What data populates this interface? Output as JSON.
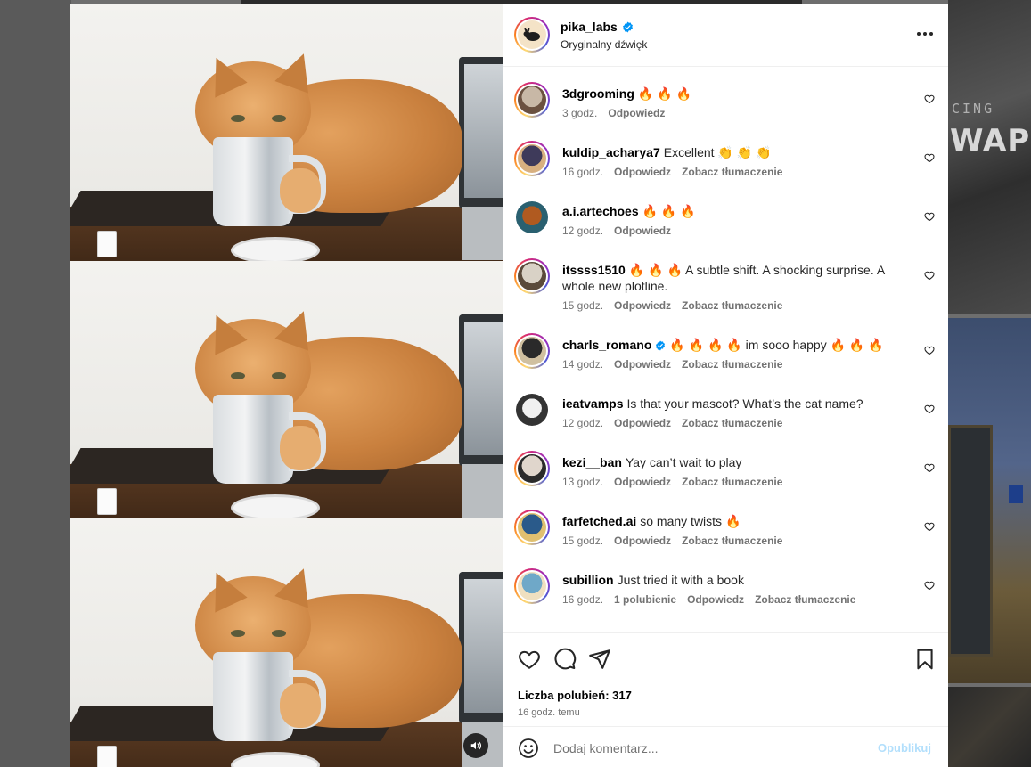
{
  "background": {
    "right_card_word_1": "CING",
    "right_card_word_2": "WAPS"
  },
  "post": {
    "author": {
      "username": "pika_labs",
      "verified": true,
      "audio": "Oryginalny dźwięk"
    },
    "comments": [
      {
        "username": "3dgrooming",
        "text": "🔥 🔥 🔥",
        "time": "3 godz.",
        "likes": "",
        "reply": "Odpowiedz",
        "translate": "",
        "ring": true
      },
      {
        "username": "kuldip_acharya7",
        "text": "Excellent 👏 👏 👏",
        "time": "16 godz.",
        "likes": "",
        "reply": "Odpowiedz",
        "translate": "Zobacz tłumaczenie",
        "ring": true
      },
      {
        "username": "a.i.artechoes",
        "text": "🔥 🔥 🔥",
        "time": "12 godz.",
        "likes": "",
        "reply": "Odpowiedz",
        "translate": "",
        "ring": false
      },
      {
        "username": "itssss1510",
        "text": "🔥 🔥 🔥 A subtle shift. A shocking surprise. A whole new plotline.",
        "time": "15 godz.",
        "likes": "",
        "reply": "Odpowiedz",
        "translate": "Zobacz tłumaczenie",
        "ring": true
      },
      {
        "username": "charls_romano",
        "verified": true,
        "text": "🔥 🔥 🔥 🔥 im sooo happy 🔥 🔥 🔥",
        "time": "14 godz.",
        "likes": "",
        "reply": "Odpowiedz",
        "translate": "Zobacz tłumaczenie",
        "ring": true
      },
      {
        "username": "ieatvamps",
        "text": "Is that your mascot? What’s the cat name?",
        "time": "12 godz.",
        "likes": "",
        "reply": "Odpowiedz",
        "translate": "Zobacz tłumaczenie",
        "ring": false
      },
      {
        "username": "kezi__ban",
        "text": "Yay can’t wait to play",
        "time": "13 godz.",
        "likes": "",
        "reply": "Odpowiedz",
        "translate": "Zobacz tłumaczenie",
        "ring": true
      },
      {
        "username": "farfetched.ai",
        "text": "so many twists 🔥",
        "time": "15 godz.",
        "likes": "",
        "reply": "Odpowiedz",
        "translate": "Zobacz tłumaczenie",
        "ring": true
      },
      {
        "username": "subillion",
        "text": "Just tried it with a book",
        "time": "16 godz.",
        "likes": "1 polubienie",
        "reply": "Odpowiedz",
        "translate": "Zobacz tłumaczenie",
        "ring": true
      }
    ],
    "likes_label": "Liczba polubień: 317",
    "posted_ago": "16 godz. temu",
    "add_comment": {
      "placeholder": "Dodaj komentarz...",
      "publish_label": "Opublikuj"
    },
    "icons": {
      "like": "heart-icon",
      "comment": "comment-bubble-icon",
      "share": "paper-plane-icon",
      "save": "bookmark-icon",
      "emoji": "emoji-smile-icon",
      "more": "more-horizontal-icon",
      "sound": "speaker-icon",
      "verified": "verified-badge-icon"
    },
    "colors": {
      "verified": "#0095f6",
      "publish_disabled": "#b2dffc",
      "secondary_text": "#737373"
    }
  }
}
